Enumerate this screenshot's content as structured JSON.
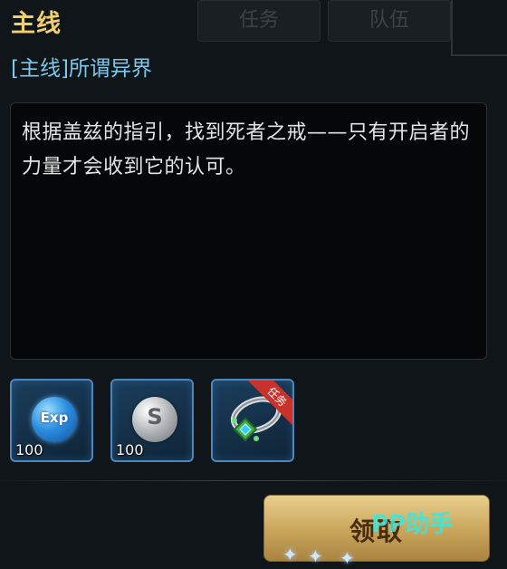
{
  "background": {
    "tabs": [
      "任务",
      "队伍"
    ]
  },
  "header": {
    "title": "主线"
  },
  "quest": {
    "name": "[主线]所谓异界",
    "description": "根据盖兹的指引，找到死者之戒——只有开启者的力量才会收到它的认可。"
  },
  "rewards": [
    {
      "icon": "exp-coin-icon",
      "label": "Exp",
      "count": "100"
    },
    {
      "icon": "silver-coin-icon",
      "label": "S",
      "count": "100"
    },
    {
      "icon": "ring-icon",
      "badge": "任务"
    }
  ],
  "claim_button": {
    "label": "领取"
  },
  "watermark": "PP助手",
  "colors": {
    "title": "#f2cf6b",
    "quest_name": "#7cc8ea",
    "slot_border": "#4d86b8",
    "button": "#c9a45a",
    "badge": "#c8322a"
  }
}
